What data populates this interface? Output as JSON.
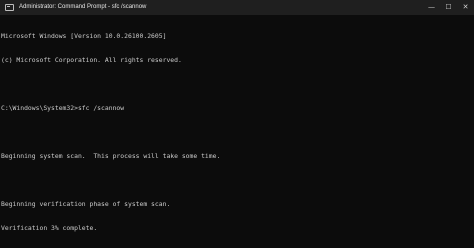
{
  "window": {
    "title": "Administrator: Command Prompt - sfc  /scannow",
    "icon": "terminal-icon",
    "controls": {
      "minimize": "—",
      "maximize": "☐",
      "close": "✕"
    }
  },
  "console": {
    "lines": [
      "Microsoft Windows [Version 10.0.26100.2605]",
      "(c) Microsoft Corporation. All rights reserved.",
      "",
      "C:\\Windows\\System32>sfc /scannow",
      "",
      "Beginning system scan.  This process will take some time.",
      "",
      "Beginning verification phase of system scan.",
      "Verification 3% complete."
    ]
  }
}
